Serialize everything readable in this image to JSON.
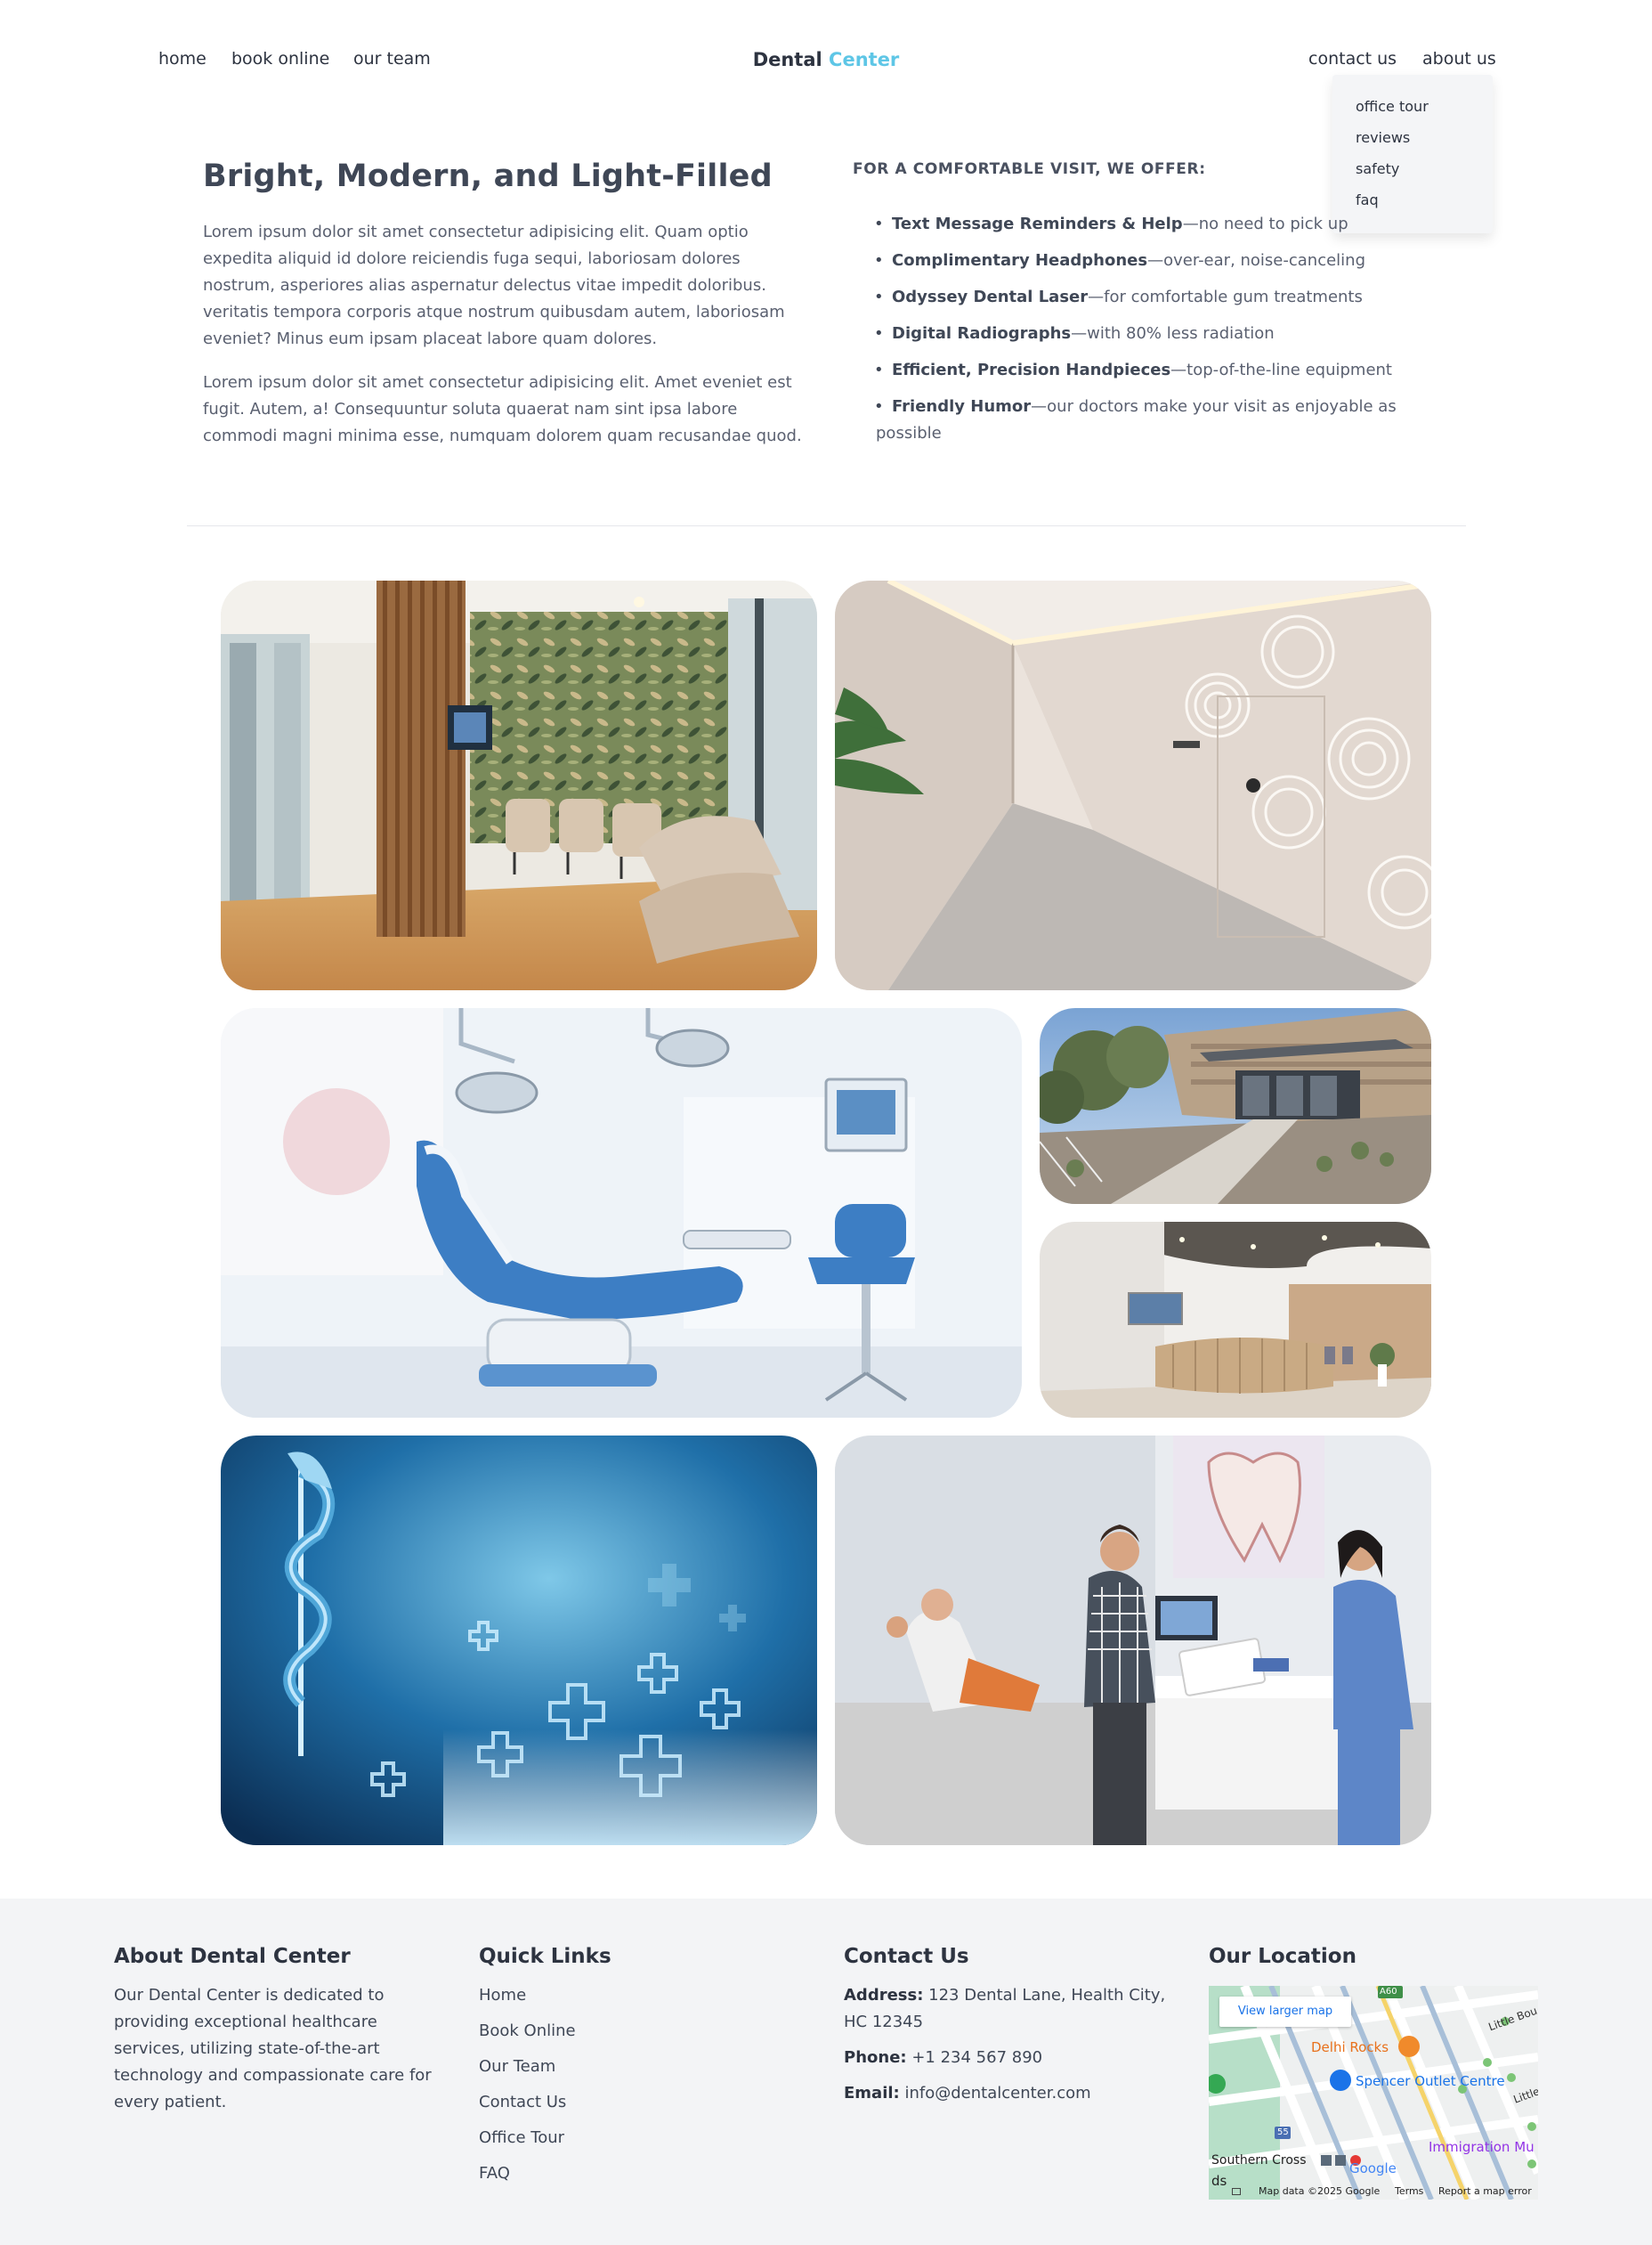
{
  "nav": {
    "left_links": [
      "home",
      "book online",
      "our team"
    ],
    "brand_main": "Dental",
    "brand_accent": "Center",
    "right_links": [
      "contact us",
      "about us"
    ],
    "dropdown": [
      "office tour",
      "reviews",
      "safety",
      "faq"
    ]
  },
  "intro": {
    "title": "Bright, Modern, and Light-Filled",
    "paragraph1": "Lorem ipsum dolor sit amet consectetur adipisicing elit. Quam optio expedita aliquid id dolore reiciendis fuga sequi, laboriosam dolores nostrum, asperiores alias aspernatur delectus vitae impedit doloribus. veritatis tempora corporis atque nostrum quibusdam autem, laboriosam eveniet? Minus eum ipsam placeat labore quam dolores.",
    "paragraph2": "Lorem ipsum dolor sit amet consectetur adipisicing elit. Amet eveniet est fugit. Autem, a! Consequuntur soluta quaerat nam sint ipsa labore commodi magni minima esse, numquam dolorem quam recusandae quod.",
    "offer_heading": "FOR A COMFORTABLE VISIT, WE OFFER:",
    "offers": [
      {
        "bold": "Text Message Reminders & Help",
        "rest": "—no need to pick up"
      },
      {
        "bold": "Complimentary Headphones",
        "rest": "—over-ear, noise-canceling"
      },
      {
        "bold": "Odyssey Dental Laser",
        "rest": "—for comfortable gum treatments"
      },
      {
        "bold": "Digital Radiographs",
        "rest": "—with 80% less radiation"
      },
      {
        "bold": "Efficient, Precision Handpieces",
        "rest": "—top-of-the-line equipment"
      },
      {
        "bold": "Friendly Humor",
        "rest": "—our doctors make your visit as enjoyable as possible"
      }
    ]
  },
  "gallery": {
    "photos": [
      "waiting-room",
      "hallway",
      "dental-chair",
      "building-exterior",
      "reception-desk",
      "medical-graphic",
      "front-desk-staff"
    ]
  },
  "footer": {
    "about_title": "About Dental Center",
    "about_text": "Our Dental Center is dedicated to providing exceptional healthcare services, utilizing state-of-the-art technology and compassionate care for every patient.",
    "links_title": "Quick Links",
    "links": [
      "Home",
      "Book Online",
      "Our Team",
      "Contact Us",
      "Office Tour",
      "FAQ"
    ],
    "contact_title": "Contact Us",
    "contact": [
      {
        "label": "Address:",
        "value": "123 Dental Lane, Health City, HC 12345"
      },
      {
        "label": "Phone:",
        "value": "+1 234 567 890"
      },
      {
        "label": "Email:",
        "value": "info@dentalcenter.com"
      }
    ],
    "location_title": "Our Location",
    "map": {
      "button": "View larger map",
      "labels": [
        "Delhi Rocks",
        "Spencer Outlet Centre",
        "Southern Cross",
        "Immigration Mu",
        "Little Bou",
        "Little",
        "A60",
        "55",
        "ds"
      ],
      "footer": [
        "Map data ©2025 Google",
        "Terms",
        "Report a map error"
      ],
      "logo": "Google"
    }
  },
  "colors": {
    "accent": "#5ec6e6",
    "text_dark": "#2d3340",
    "footer_bg": "#f3f4f6"
  }
}
